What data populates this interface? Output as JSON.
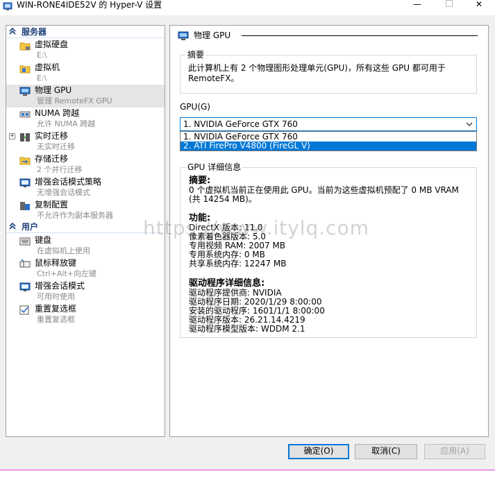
{
  "window": {
    "title": "WIN-RONE4IDE52V 的 Hyper-V 设置",
    "minimize_glyph": "—",
    "close_glyph": "✕"
  },
  "sidebar": {
    "categories": [
      {
        "label": "服务器"
      },
      {
        "label": "用户"
      }
    ],
    "items": [
      {
        "label": "虚拟硬盘",
        "sub": "E:\\",
        "icon": "folder-disk-icon"
      },
      {
        "label": "虚拟机",
        "sub": "E:\\",
        "icon": "vm-file-icon"
      },
      {
        "label": "物理 GPU",
        "sub": "管理 RemoteFX GPU",
        "icon": "gpu-monitor-icon"
      },
      {
        "label": "NUMA 跨越",
        "sub": "允许 NUMA 跨越",
        "icon": "numa-icon"
      },
      {
        "label": "实时迁移",
        "sub": "无实时迁移",
        "icon": "live-migration-icon",
        "expander": "+"
      },
      {
        "label": "存储迁移",
        "sub": "2 个并行迁移",
        "icon": "storage-migration-icon"
      },
      {
        "label": "增强会话模式策略",
        "sub": "无增强会话模式",
        "icon": "session-policy-icon"
      },
      {
        "label": "复制配置",
        "sub": "不允许作为副本服务器",
        "icon": "replication-icon"
      },
      {
        "label": "键盘",
        "sub": "在虚拟机上使用",
        "icon": "keyboard-icon"
      },
      {
        "label": "鼠标释放键",
        "sub": "Ctrl+Alt+向左键",
        "icon": "mouse-icon"
      },
      {
        "label": "增强会话模式",
        "sub": "可用时使用",
        "icon": "session-icon"
      },
      {
        "label": "重置复选框",
        "sub": "重置复选框",
        "icon": "reset-checkbox-icon"
      }
    ]
  },
  "panel": {
    "title": "物理 GPU",
    "summary_legend": "摘要",
    "summary_text": "此计算机上有 2 个物理图形处理单元(GPU)，所有这些 GPU 都可用于 RemoteFX。",
    "gpu_label": "GPU(G)",
    "gpu_selected": "1. NVIDIA GeForce GTX 760",
    "gpu_options": [
      "1. NVIDIA GeForce GTX 760",
      "2. ATI FirePro V4800 (FireGL V)"
    ],
    "details_legend": "GPU 详细信息",
    "details": {
      "summary_head": "摘要:",
      "summary_body": "0 个虚拟机当前正在使用此 GPU。当前为这些虚拟机预配了 0 MB VRAM (共 14254 MB)。",
      "features_head": "功能:",
      "features": [
        "DirectX 版本: 11.0",
        "像素着色器版本: 5.0",
        "专用视频 RAM: 2007 MB",
        "专用系统内存: 0 MB",
        "共享系统内存: 12247 MB"
      ],
      "driver_head": "驱动程序详细信息:",
      "driver": [
        "驱动程序提供商: NVIDIA",
        "驱动程序日期: 2020/1/29 8:00:00",
        "安装的驱动程序: 1601/1/1 8:00:00",
        "驱动程序版本: 26.21.14.4219",
        "驱动程序模型版本: WDDM 2.1"
      ]
    }
  },
  "watermark": "https://www.itylq.com",
  "buttons": {
    "ok": "确定(O)",
    "cancel": "取消(C)",
    "apply": "应用(A)"
  },
  "colors": {
    "accent": "#0078d7",
    "category_text": "#1b3e7a",
    "selected_row": "#e5e5e5"
  }
}
